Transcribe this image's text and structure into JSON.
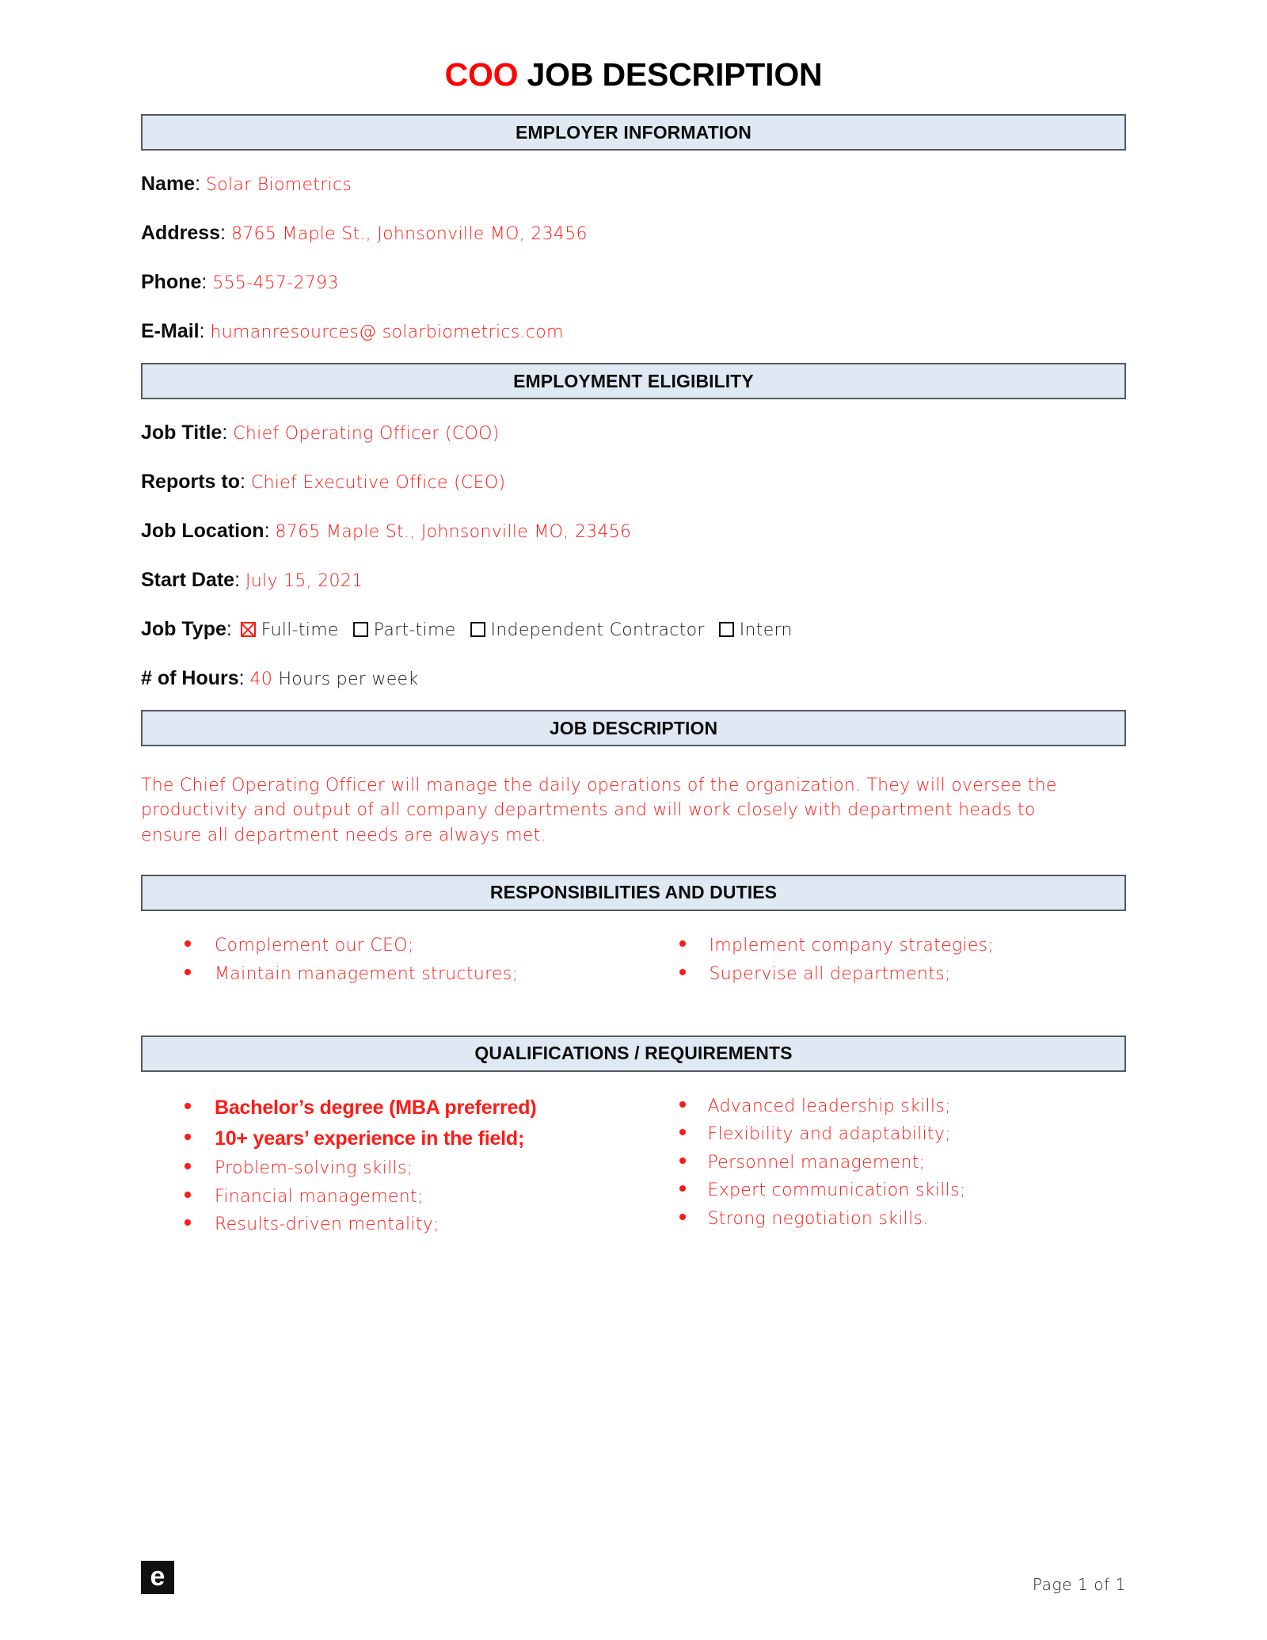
{
  "title": {
    "accent": "COO",
    "rest": " JOB DESCRIPTION"
  },
  "colors": {
    "accent_red": "#ff0000",
    "fill_red": "#ff1a15",
    "section_bar_bg": "#dfe8f3",
    "section_bar_border": "#555a60"
  },
  "sections": {
    "employer_information": {
      "heading": "EMPLOYER INFORMATION",
      "fields": [
        {
          "label": "Name",
          "value": "Solar Biometrics"
        },
        {
          "label": "Address",
          "value": "8765 Maple St., Johnsonville MO, 23456"
        },
        {
          "label": "Phone",
          "value": "555-457-2793"
        },
        {
          "label": "E-Mail",
          "value": "humanresources@ solarbiometrics.com"
        }
      ]
    },
    "employment_eligibility": {
      "heading": "EMPLOYMENT ELIGIBILITY",
      "fields": [
        {
          "label": "Job Title",
          "value": "Chief Operating Officer (COO)"
        },
        {
          "label": "Reports to",
          "value": "Chief Executive Office (CEO)"
        },
        {
          "label": "Job Location",
          "value": "8765 Maple St., Johnsonville MO, 23456"
        },
        {
          "label": "Start Date",
          "value": "July 15, 2021"
        }
      ],
      "job_type": {
        "label": "Job Type",
        "options": [
          {
            "label": "Full-time",
            "checked": true
          },
          {
            "label": "Part-time",
            "checked": false
          },
          {
            "label": "Independent Contractor",
            "checked": false
          },
          {
            "label": "Intern",
            "checked": false
          }
        ]
      },
      "hours": {
        "label": "# of Hours",
        "value": "40",
        "suffix": "Hours per week"
      }
    },
    "job_description": {
      "heading": "JOB DESCRIPTION",
      "body": "The Chief Operating Officer will manage the daily operations of the organization. They will oversee the productivity and output of all company departments and will work closely with department heads to ensure all department needs are always met."
    },
    "responsibilities": {
      "heading": "RESPONSIBILITIES AND DUTIES",
      "left": [
        {
          "text": "Complement our CEO;",
          "emphasis": false
        },
        {
          "text": "Maintain management structures;",
          "emphasis": false
        }
      ],
      "right": [
        {
          "text": "Implement company strategies;",
          "emphasis": false
        },
        {
          "text": "Supervise all departments;",
          "emphasis": false
        }
      ]
    },
    "qualifications": {
      "heading": "QUALIFICATIONS / REQUIREMENTS",
      "left": [
        {
          "text": "Bachelor’s degree (MBA preferred)",
          "emphasis": true
        },
        {
          "text": "10+ years’ experience in the field;",
          "emphasis": true
        },
        {
          "text": "Problem-solving skills;",
          "emphasis": false
        },
        {
          "text": "Financial management;",
          "emphasis": false
        },
        {
          "text": "Results-driven mentality;",
          "emphasis": false
        }
      ],
      "right": [
        {
          "text": "Advanced leadership skills;",
          "emphasis": false
        },
        {
          "text": "Flexibility and adaptability;",
          "emphasis": false
        },
        {
          "text": "Personnel management;",
          "emphasis": false
        },
        {
          "text": "Expert communication skills;",
          "emphasis": false
        },
        {
          "text": "Strong negotiation skills.",
          "emphasis": false
        }
      ]
    }
  },
  "footer": {
    "logo_letter": "e",
    "page_number": "Page 1 of 1"
  }
}
